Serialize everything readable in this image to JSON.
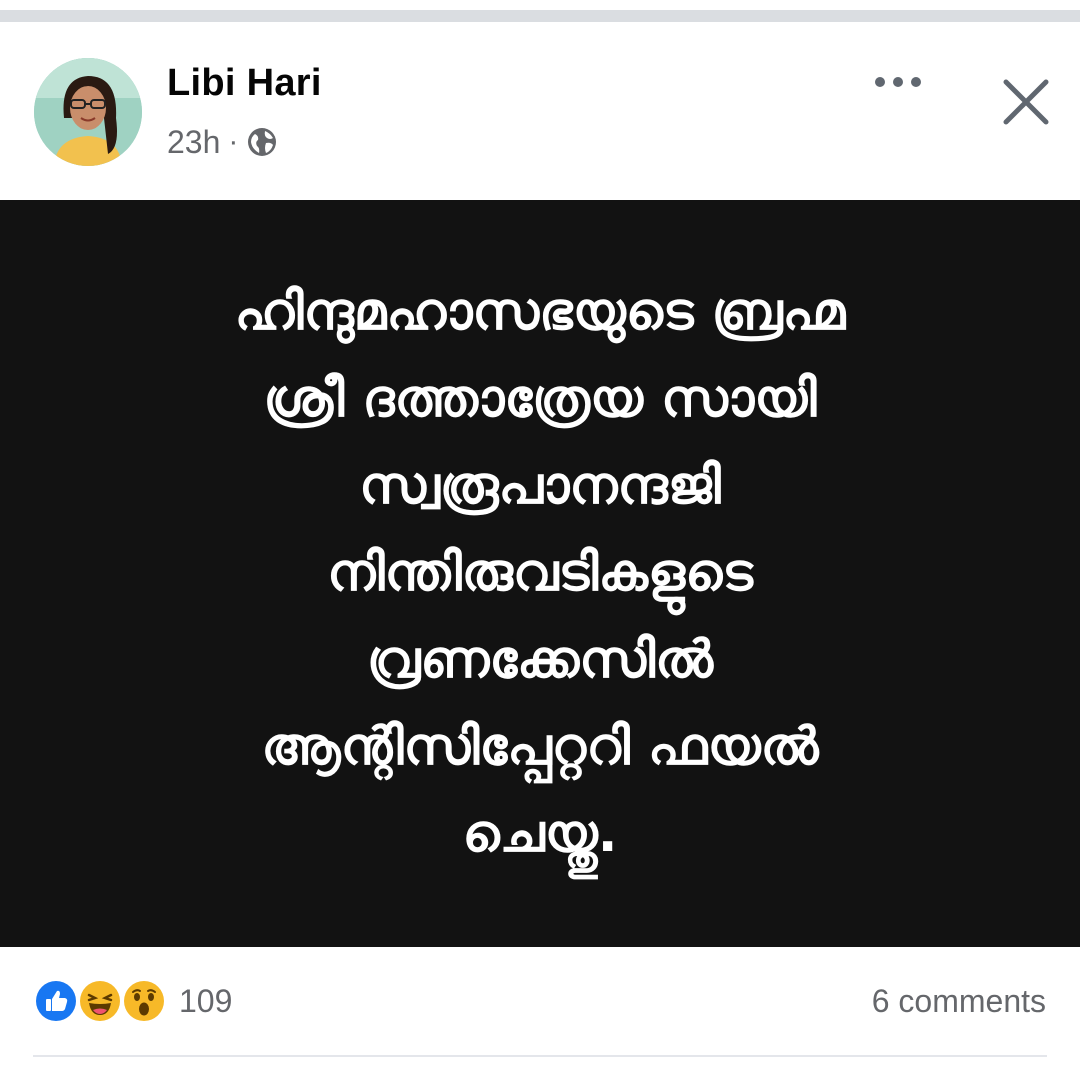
{
  "post": {
    "author": "Libi Hari",
    "time": "23h",
    "separator": "·",
    "privacy_icon": "globe-icon",
    "image_text_lines": [
      "ഹിന്ദുമഹാസഭയുടെ ബ്രഹ്മ",
      "ശ്രീ ദത്താത്രേയ സായി",
      "സ്വരൂപാനന്ദജി",
      "നിന്തിരുവടികളുടെ",
      "വ്രണക്കേസിൽ",
      "ആന്റിസിപ്പേറ്ററി ഫയൽ",
      "ചെയ്തു."
    ]
  },
  "reactions": {
    "icons": [
      "like-icon",
      "haha-icon",
      "wow-icon"
    ],
    "count": "109"
  },
  "comments": {
    "label": "6 comments"
  },
  "colors": {
    "image_background": "#121212",
    "image_text": "#ffffff",
    "like_blue": "#1877f2",
    "emoji_yellow": "#f7b928",
    "secondary_text": "#65676b"
  }
}
